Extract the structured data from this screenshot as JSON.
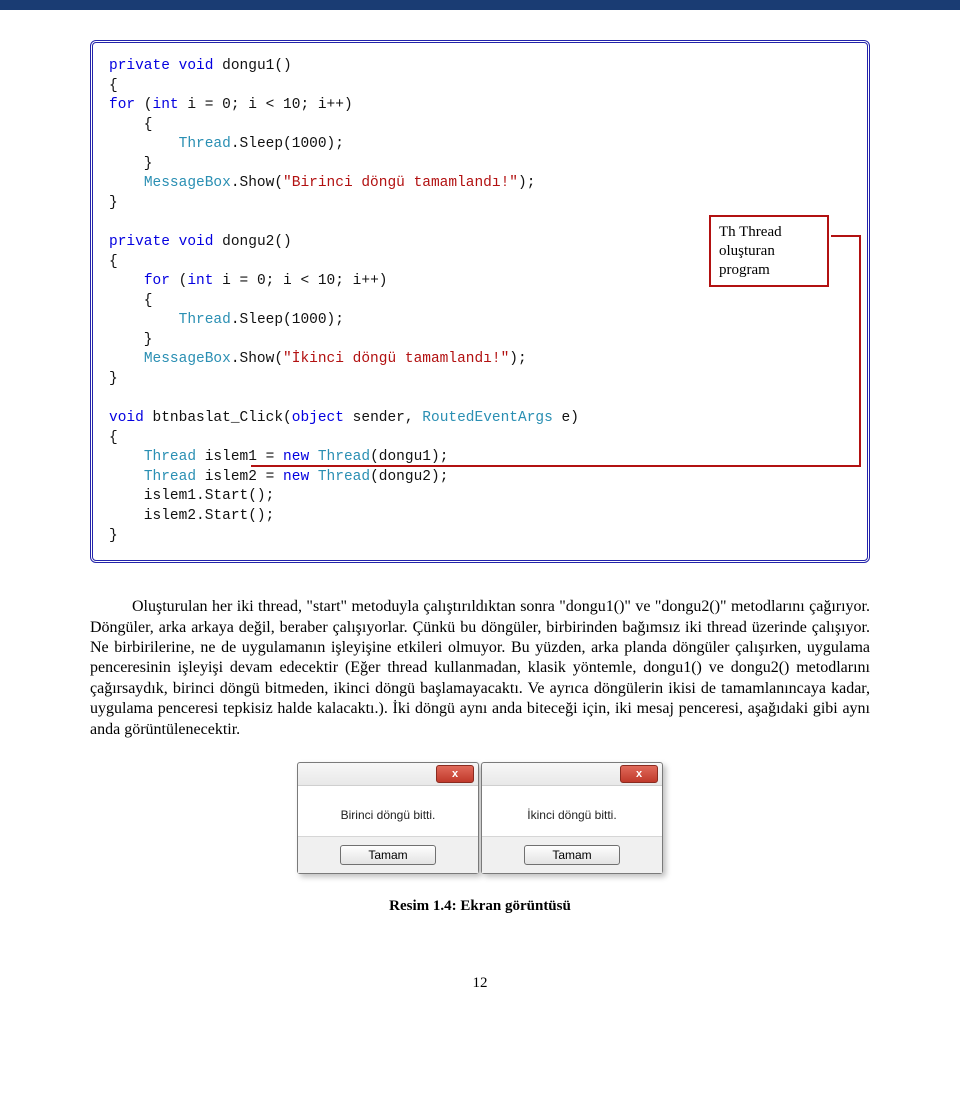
{
  "code": {
    "l1a": "private",
    "l1b": "void",
    "l1c": " dongu1()",
    "l2": "{",
    "l3a": "for",
    "l3b": " (",
    "l3c": "int",
    "l3d": " i = 0; i < 10; i++)",
    "l4": "    {",
    "l5a": "        ",
    "l5b": "Thread",
    "l5c": ".Sleep(1000);",
    "l6": "    }",
    "l7a": "    ",
    "l7b": "MessageBox",
    "l7c": ".Show(",
    "l7d": "\"Birinci döngü tamamlandı!\"",
    "l7e": ");",
    "l8": "}",
    "l9": "",
    "l10a": "private",
    "l10b": "void",
    "l10c": " dongu2()",
    "l11": "{",
    "l12a": "    ",
    "l12b": "for",
    "l12c": " (",
    "l12d": "int",
    "l12e": " i = 0; i < 10; i++)",
    "l13": "    {",
    "l14a": "        ",
    "l14b": "Thread",
    "l14c": ".Sleep(1000);",
    "l15": "    }",
    "l16a": "    ",
    "l16b": "MessageBox",
    "l16c": ".Show(",
    "l16d": "\"İkinci döngü tamamlandı!\"",
    "l16e": ");",
    "l17": "}",
    "l18": "",
    "l19a": "void",
    "l19b": " btnbaslat_Click(",
    "l19c": "object",
    "l19d": " sender, ",
    "l19e": "RoutedEventArgs",
    "l19f": " e)",
    "l20": "{",
    "l21a": "    ",
    "l21b": "Thread",
    "l21c": " islem1 = ",
    "l21d": "new",
    "l21e": " ",
    "l21f": "Thread",
    "l21g": "(dongu1);",
    "l22a": "    ",
    "l22b": "Thread",
    "l22c": " islem2 = ",
    "l22d": "new",
    "l22e": " ",
    "l22f": "Thread",
    "l22g": "(dongu2);",
    "l23": "    islem1.Start();",
    "l24": "    islem2.Start();",
    "l25": "}"
  },
  "callout": {
    "l1": "Th  Thread",
    "l2": "oluşturan",
    "l3": "program"
  },
  "paragraph": "Oluşturulan her iki thread, \"start\" metoduyla çalıştırıldıktan sonra \"dongu1()\" ve \"dongu2()\" metodlarını çağırıyor. Döngüler, arka arkaya değil, beraber çalışıyorlar. Çünkü bu döngüler, birbirinden bağımsız iki thread üzerinde çalışıyor. Ne birbirilerine, ne de uygulamanın işleyişine etkileri olmuyor. Bu yüzden, arka planda döngüler çalışırken, uygulama penceresinin işleyişi devam edecektir (Eğer thread kullanmadan, klasik yöntemle, dongu1() ve dongu2() metodlarını çağırsaydık, birinci döngü bitmeden, ikinci döngü başlamayacaktı. Ve ayrıca döngülerin ikisi de tamamlanıncaya kadar, uygulama penceresi tepkisiz halde kalacaktı.). İki döngü aynı anda biteceği için, iki mesaj penceresi, aşağıdaki gibi aynı anda görüntülenecektir.",
  "dialogs": {
    "left": {
      "content": "Birinci döngü bitti.",
      "ok": "Tamam",
      "close": "x"
    },
    "right": {
      "content": "İkinci döngü bitti.",
      "ok": "Tamam",
      "close": "x"
    }
  },
  "caption": "Resim 1.4: Ekran görüntüsü",
  "pagenum": "12"
}
